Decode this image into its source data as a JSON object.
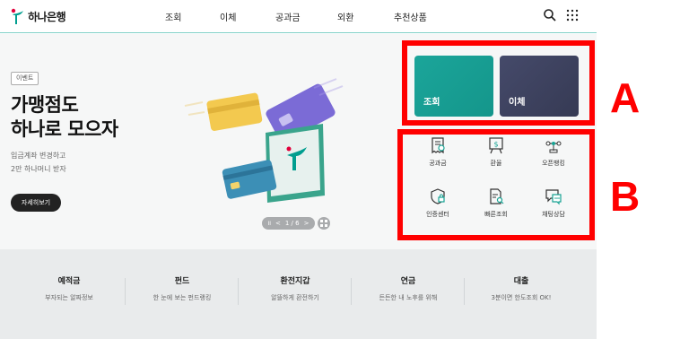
{
  "brand": {
    "name": "하나은행"
  },
  "nav": [
    "조회",
    "이체",
    "공과금",
    "외환",
    "추천상품"
  ],
  "header_tools": {
    "search_icon": "search-icon",
    "menu_icon": "all-menu-grid-icon"
  },
  "hero": {
    "tag": "이벤트",
    "title_line1": "가맹점도",
    "title_line2": "하나로 모으자",
    "desc_line1": "입금계좌 변경하고",
    "desc_line2": "2만 하나머니 받자",
    "button": "자세히보기",
    "pager": {
      "pause": "II",
      "prev": "<",
      "current": "1 / 6",
      "next": ">"
    }
  },
  "quick_cards": [
    {
      "label": "조회",
      "color": "#14968b"
    },
    {
      "label": "이체",
      "color": "#3a3e5a"
    }
  ],
  "services": [
    {
      "label": "공과금",
      "icon": "bill-icon"
    },
    {
      "label": "환율",
      "icon": "exchange-rate-board-icon"
    },
    {
      "label": "오픈뱅킹",
      "icon": "open-banking-icon"
    },
    {
      "label": "인증센터",
      "icon": "certificate-shield-icon"
    },
    {
      "label": "빠른조회",
      "icon": "document-search-icon"
    },
    {
      "label": "채팅상담",
      "icon": "chat-icon"
    }
  ],
  "bottom_links": [
    {
      "title": "예적금",
      "desc": "부자되는 알짜정보"
    },
    {
      "title": "펀드",
      "desc": "한 눈에 보는 펀드랭킹"
    },
    {
      "title": "환전지갑",
      "desc": "알뜰하게 환전하기"
    },
    {
      "title": "연금",
      "desc": "든든한 내 노후를 위해"
    },
    {
      "title": "대출",
      "desc": "3분이면 한도조회 OK!"
    }
  ],
  "annotations": {
    "label_a": "A",
    "label_b": "B",
    "color": "#ff0000"
  }
}
